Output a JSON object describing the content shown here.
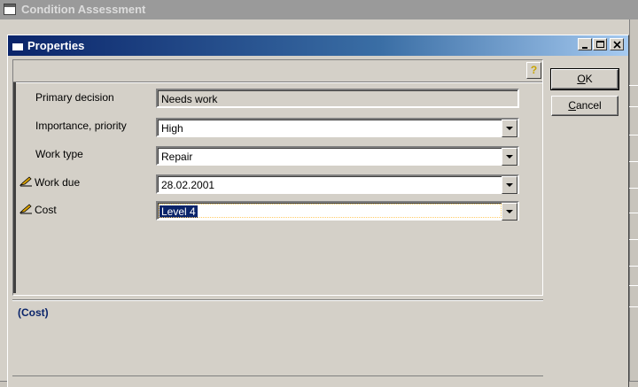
{
  "background_window": {
    "title": "Condition Assessment"
  },
  "dialog": {
    "title": "Properties",
    "caption_buttons": [
      "minimize",
      "maximize",
      "close"
    ],
    "help_icon": "help-icon"
  },
  "fields": [
    {
      "label": "Primary decision",
      "value": "Needs work",
      "editable": false,
      "dropdown": false,
      "pen_icon": false
    },
    {
      "label": "Importance, priority",
      "value": "High",
      "editable": true,
      "dropdown": true,
      "pen_icon": false
    },
    {
      "label": "Work type",
      "value": "Repair",
      "editable": true,
      "dropdown": true,
      "pen_icon": false
    },
    {
      "label": "Work due",
      "value": "28.02.2001",
      "editable": true,
      "dropdown": true,
      "pen_icon": true
    },
    {
      "label": "Cost",
      "value": "Level 4",
      "editable": true,
      "dropdown": true,
      "pen_icon": true,
      "selected": true
    }
  ],
  "buttons": {
    "ok": "OK",
    "cancel": "Cancel"
  },
  "description": "(Cost)",
  "colors": {
    "title_active": "#0a246a",
    "title_inactive": "#9a9a9a",
    "face": "#d4d0c8",
    "selection": "#0a246a"
  }
}
